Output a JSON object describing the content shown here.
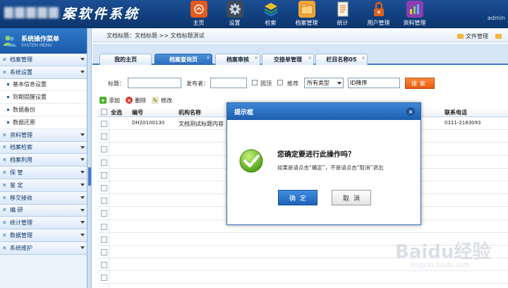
{
  "header": {
    "logo_text": "案软件系统",
    "user": "admin",
    "nav": [
      {
        "label": "主页",
        "icon": "home-icon",
        "color": "#e85a1b"
      },
      {
        "label": "设置",
        "icon": "gear-icon",
        "color": "#5b6b7d"
      },
      {
        "label": "检索",
        "icon": "layers-icon",
        "color": "#2f9a4a"
      },
      {
        "label": "档案管理",
        "icon": "folder-icon",
        "color": "#f1a53a"
      },
      {
        "label": "统计",
        "icon": "document-icon",
        "color": "#f4f1e6"
      },
      {
        "label": "用户管理",
        "icon": "lock-icon",
        "color": "#e0601e"
      },
      {
        "label": "资料管理",
        "icon": "bar-chart-icon",
        "color": "#8a3fb0"
      }
    ]
  },
  "sidebar": {
    "title": "系统操作菜单",
    "subtitle": "SYSTEM MENU",
    "groups_top": [
      {
        "label": "档案管理"
      },
      {
        "label": "系统设置"
      }
    ],
    "sub_items": [
      {
        "label": "基本信息设置"
      },
      {
        "label": "到期提醒设置"
      },
      {
        "label": "数据备份"
      },
      {
        "label": "数据还原"
      }
    ],
    "groups_bottom": [
      {
        "label": "资料管理"
      },
      {
        "label": "档案检索"
      },
      {
        "label": "档案利用"
      },
      {
        "label": "保    管"
      },
      {
        "label": "鉴    定"
      },
      {
        "label": "移交接收"
      },
      {
        "label": "编    研"
      },
      {
        "label": "统计管理"
      },
      {
        "label": "数据管理"
      },
      {
        "label": "系统维护"
      }
    ]
  },
  "breadcrumb": {
    "text": "文档标题：文档标题 >> 文档标题测试",
    "right_1": "文件管理",
    "right_2": ""
  },
  "tabs": [
    {
      "label": "我的主页",
      "active": false
    },
    {
      "label": "档案查询页",
      "active": true
    },
    {
      "label": "档案审核",
      "active": false
    },
    {
      "label": "交接单管理",
      "active": false
    },
    {
      "label": "栏目名称05",
      "active": false
    }
  ],
  "search": {
    "label_title": "标题：",
    "label_publisher": "发布者：",
    "label_top": "固顶",
    "label_recommend": "推荐",
    "type_select": "所有类型",
    "order_input": "ID降序",
    "search_button": "搜索"
  },
  "toolbar": {
    "add": "添加",
    "delete": "删除",
    "edit": "修改"
  },
  "grid": {
    "headers": {
      "select_all": "全选",
      "code": "编号",
      "org_name": "机构名称",
      "phone": "联系电话"
    },
    "rows": [
      {
        "code": "DH20100130",
        "org_name": "文档测试标题内容",
        "phone": "0311-2183093"
      }
    ]
  },
  "dialog": {
    "title": "提示框",
    "question": "您确定要进行此操作吗？",
    "hint": "如果是请点击“确定”，不是请点击“取消”退出",
    "ok": "确定",
    "cancel": "取消"
  },
  "watermark": {
    "logo": "Baidu经验",
    "url": "jingyan.baidu.com"
  }
}
